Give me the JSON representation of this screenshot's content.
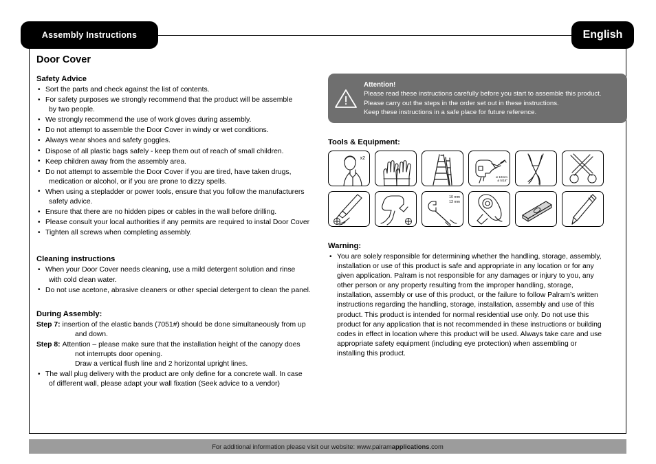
{
  "header": {
    "assembly_badge": "Assembly Instructions",
    "language_badge": "English"
  },
  "doc_title": "Door Cover",
  "safety": {
    "heading": "Safety Advice",
    "items": [
      {
        "text": "Sort the parts and check against the list of contents."
      },
      {
        "text": "For safety purposes we strongly recommend that the product will be assemble",
        "cont": "by two people."
      },
      {
        "text": "We strongly recommend the use of work gloves during assembly."
      },
      {
        "text": "Do not attempt to assemble the Door Cover in windy or wet conditions."
      },
      {
        "text": "Always wear shoes and safety goggles."
      },
      {
        "text": "Dispose of all plastic bags safely - keep them out of reach of small children."
      },
      {
        "text": "Keep children away from the assembly area."
      },
      {
        "text": "Do not attempt to assemble the Door Cover if you are tired, have taken drugs,",
        "cont": "medication or alcohol, or if you are prone to dizzy spells."
      },
      {
        "text": "When using a stepladder or power tools, ensure that you follow the manufacturers",
        "cont": "safety advice."
      },
      {
        "text": "Ensure that there are no hidden pipes or cables in the wall before drilling."
      },
      {
        "text": "Please consult your local authorities if any permits are required to instal Door Cover"
      },
      {
        "text": "Tighten all screws when completing assembly."
      }
    ]
  },
  "cleaning": {
    "heading": "Cleaning instructions",
    "items": [
      {
        "text": "When your Door Cover needs cleaning, use a mild detergent solution and rinse",
        "cont": "with cold clean water."
      },
      {
        "text": "Do not use acetone, abrasive cleaners or other special detergent to clean the panel."
      }
    ]
  },
  "during_assembly": {
    "heading": "During Assembly:",
    "steps": [
      {
        "label": "Step 7:",
        "text": "insertion of the elastic bands (7051#) should be done simultaneously from up",
        "indented": [
          "and down."
        ]
      },
      {
        "label": "Step 8:",
        "text": "Attention – please make sure that the installation height of the canopy does",
        "indented": [
          "not interrupts door opening.",
          "Draw a vertical flush line and 2 horizontal upright lines."
        ]
      }
    ],
    "bullet": {
      "text": "The wall plug delivery with the product are only define for a concrete wall. In case",
      "cont": "of different wall, please adapt your wall fixation (Seek advice to a vendor)"
    }
  },
  "attention": {
    "title": "Attention!",
    "lines": [
      "Please read these instructions carefully before you start to assemble this product.",
      "Please carry out the steps in the order set out in these instructions.",
      "Keep these instructions in a safe place for future reference."
    ],
    "icon": "warning-triangle-icon",
    "background": "#6f6f6f"
  },
  "tools": {
    "heading": "Tools & Equipment:",
    "row1": [
      {
        "icon": "person-icon",
        "label": "x2"
      },
      {
        "icon": "gloves-icon",
        "label": ""
      },
      {
        "icon": "stepladder-icon",
        "label": ""
      },
      {
        "icon": "power-drill-icon",
        "label": "ø 10mm",
        "label2": "ø 5/16\""
      },
      {
        "icon": "pliers-icon",
        "label": ""
      },
      {
        "icon": "scissors-icon",
        "label": ""
      }
    ],
    "row2": [
      {
        "icon": "screwdriver-icon",
        "label": ""
      },
      {
        "icon": "electric-screwdriver-icon",
        "label": ""
      },
      {
        "icon": "wrench-icon",
        "label": "10 mm",
        "label2": "13 mm"
      },
      {
        "icon": "tape-measure-icon",
        "label": ""
      },
      {
        "icon": "spirit-level-icon",
        "label": ""
      },
      {
        "icon": "pencil-icon",
        "label": ""
      }
    ]
  },
  "warning": {
    "heading": "Warning:",
    "text": "You are solely responsible for determining whether the handling, storage, assembly, installation or use of this product is safe and appropriate in any location or for any given application. Palram is not responsible for any damages or injury to you, any other person or any property resulting from the improper handling, storage, installation, assembly or use of this product, or the failure to follow Palram’s written instructions regarding the handling, storage, installation, assembly and use of this product. This product is intended for normal residential use only. Do not use this product for any application that is not recommended in these instructions or building codes in effect in location where this product will be used. Always take care and use appropriate safety equipment (including eye protection) when assembling or installing this product."
  },
  "footer": {
    "prefix": "For additional information please visit our website: www.palram",
    "bold": "applications",
    "suffix": ".com",
    "background": "#9c9c9c"
  }
}
